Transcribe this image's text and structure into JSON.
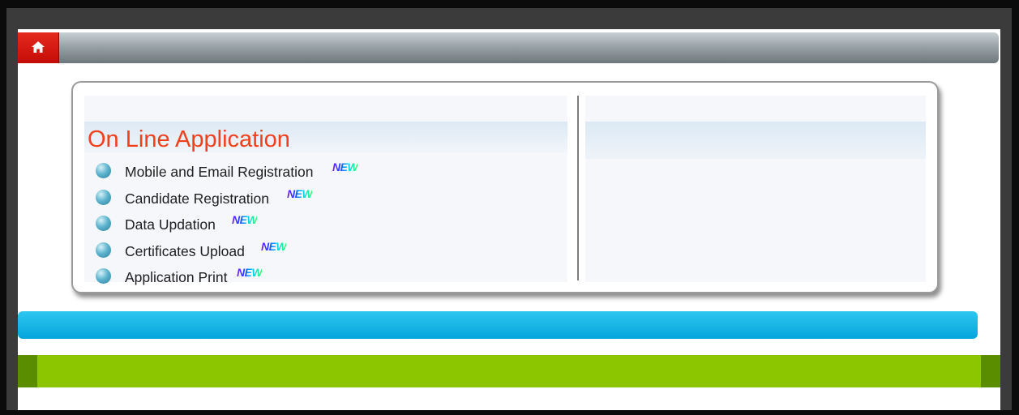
{
  "panel": {
    "title": "On Line Application",
    "items": [
      {
        "label": "Mobile and Email Registration",
        "badge": "NEW"
      },
      {
        "label": "Candidate Registration",
        "badge": "NEW"
      },
      {
        "label": "Data Updation",
        "badge": "NEW"
      },
      {
        "label": "Certificates Upload",
        "badge": "NEW"
      },
      {
        "label": "Application Print",
        "badge": "NEW"
      }
    ]
  },
  "colors": {
    "home_button": "#d91a12",
    "title": "#f0401e",
    "blue_bar": "#0aaee2",
    "green_bar": "#8cc600"
  },
  "icons": {
    "home": "home-icon",
    "bullet": "globe-bullet-icon"
  }
}
